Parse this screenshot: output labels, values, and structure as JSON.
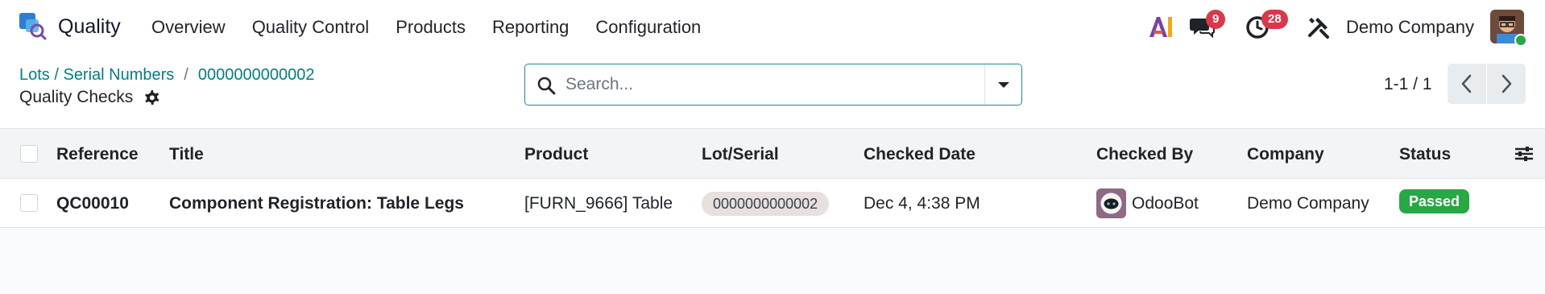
{
  "navbar": {
    "app_name": "Quality",
    "menu": [
      "Overview",
      "Quality Control",
      "Products",
      "Reporting",
      "Configuration"
    ],
    "chat_count": "9",
    "activity_count": "28",
    "company": "Demo Company",
    "ai_label": "AI"
  },
  "control": {
    "breadcrumb": [
      "Lots / Serial Numbers",
      "0000000000002"
    ],
    "breadcrumb_separator": "/",
    "title": "Quality Checks",
    "search_placeholder": "Search...",
    "pager": "1-1 / 1"
  },
  "table": {
    "columns": [
      "Reference",
      "Title",
      "Product",
      "Lot/Serial",
      "Checked Date",
      "Checked By",
      "Company",
      "Status"
    ],
    "rows": [
      {
        "reference": "QC00010",
        "title": "Component Registration: Table Legs",
        "product": "[FURN_9666] Table",
        "lot": "0000000000002",
        "checked_date": "Dec 4, 4:38 PM",
        "checked_by": "OdooBot",
        "company": "Demo Company",
        "status": "Passed"
      }
    ]
  },
  "colors": {
    "accent": "#017e84",
    "badge": "#d9384a",
    "passed": "#28a745"
  }
}
